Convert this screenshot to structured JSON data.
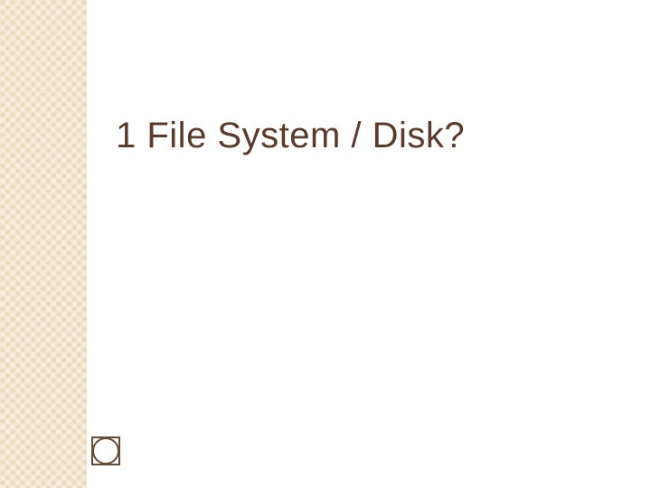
{
  "slide": {
    "title": "1 File System / Disk?"
  },
  "colors": {
    "sidebar": "#e8d9b8",
    "title_text": "#5b3a29",
    "ornament_stroke": "#6b4a33"
  }
}
